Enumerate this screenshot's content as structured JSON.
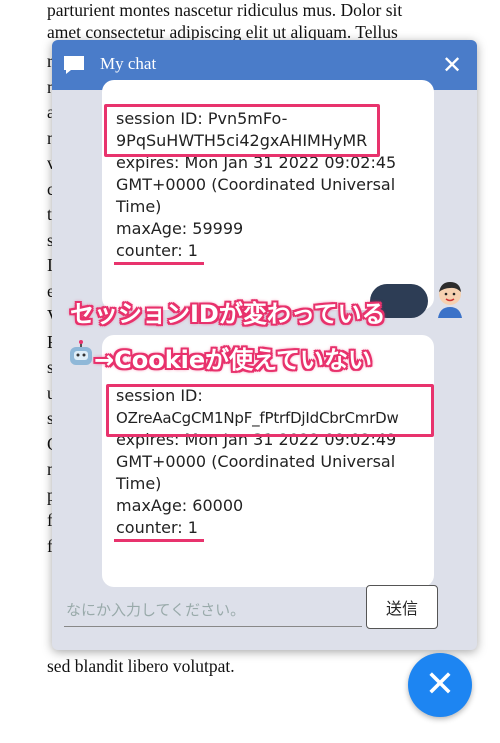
{
  "background": {
    "line1": "parturient montes nascetur ridiculus mus. Dolor sit",
    "line2": "amet consectetur adipiscing elit ut aliquam. Tellus",
    "last_line": "sed blandit libero volutpat.",
    "left_letters": [
      "r",
      "n",
      "a",
      "n",
      "v",
      "c",
      "t",
      "s",
      "I",
      "e",
      "V",
      "F",
      "s",
      "u",
      "s",
      "C",
      "n",
      "p",
      "f",
      "f"
    ]
  },
  "chat": {
    "title": "My chat",
    "close_glyph": "✕",
    "messages": [
      {
        "session_label": "session ID: Pvn5mFo-",
        "session_label2": "9PqSuHWTH5ci42gxAHIMHyMR",
        "expires1": "expires: Mon Jan 31 2022 09:02:45",
        "expires2": "GMT+0000 (Coordinated Universal",
        "expires3": "Time)",
        "maxage": "maxAge: 59999",
        "counter": "counter: 1"
      },
      {
        "session_label": "session ID:",
        "session_label2": "OZreAaCgCM1NpF_fPtrfDjIdCbrCmrDw",
        "expires1": "expires: Mon Jan 31 2022 09:02:49",
        "expires2": "GMT+0000 (Coordinated Universal",
        "expires3": "Time)",
        "maxage": "maxAge: 60000",
        "counter": "counter: 1"
      }
    ],
    "input_placeholder": "なにか入力してください。",
    "send_label": "送信"
  },
  "annotations": {
    "line1": "セッションIDが変わっている",
    "line2": "→Cookieが使えていない"
  },
  "fab_glyph": "✕",
  "colors": {
    "header": "#4a7cc9",
    "highlight": "#e8336d",
    "fab": "#1d85f2",
    "chat_bg": "#dde0ea"
  }
}
